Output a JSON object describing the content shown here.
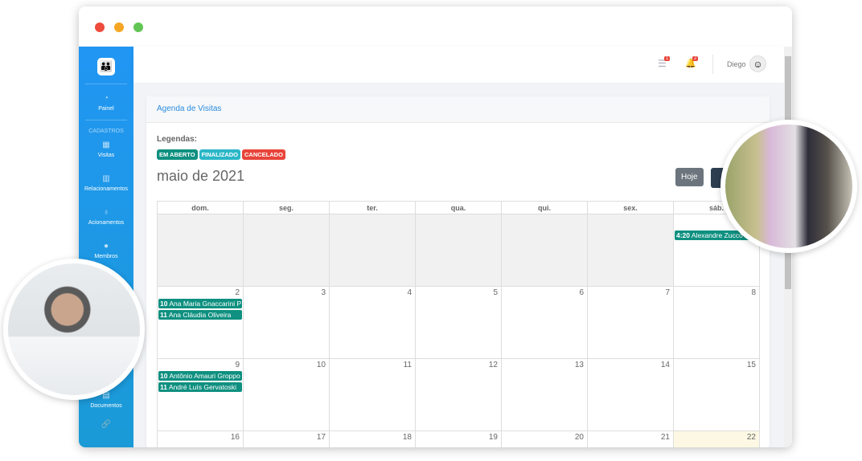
{
  "window": {
    "dots": [
      "#ee4b3d",
      "#f5a623",
      "#62c554"
    ]
  },
  "sidebar": {
    "items": [
      {
        "label": "Painel",
        "icon": "dashboard-icon"
      },
      {
        "label": "Visitas",
        "icon": "calendar-icon"
      },
      {
        "label": "Relacionamentos",
        "icon": "building-icon"
      },
      {
        "label": "Acionamentos",
        "icon": "stethoscope-icon"
      },
      {
        "label": "Membros",
        "icon": "user-icon"
      },
      {
        "label": "Documentos",
        "icon": "document-icon"
      }
    ],
    "section": "CADASTROS"
  },
  "header": {
    "tasks_count": "1",
    "notif_count": "2",
    "user": "Diego"
  },
  "card": {
    "title": "Agenda de Visitas",
    "legend_label": "Legendas:",
    "legends": [
      {
        "label": "EM ABERTO",
        "color": "#0f9080"
      },
      {
        "label": "FINALIZADO",
        "color": "#2bb7c7"
      },
      {
        "label": "CANCELADO",
        "color": "#e8443a"
      }
    ],
    "month": "maio de 2021",
    "today_button": "Hoje"
  },
  "calendar": {
    "days": [
      "dom.",
      "seg.",
      "ter.",
      "qua.",
      "qui.",
      "sex.",
      "sáb."
    ],
    "weeks": [
      {
        "cells": [
          "",
          "",
          "",
          "",
          "",
          "",
          ""
        ],
        "events_sat": [
          {
            "time": "4:20",
            "name": "Alexandre Zucco"
          }
        ]
      },
      {
        "cells": [
          "2",
          "3",
          "4",
          "5",
          "6",
          "7",
          "8"
        ],
        "events_sun": [
          {
            "time": "10",
            "name": "Ana Maria Gnaccarini P"
          },
          {
            "time": "11",
            "name": "Ana Cláudia Oliveira"
          }
        ]
      },
      {
        "cells": [
          "9",
          "10",
          "11",
          "12",
          "13",
          "14",
          "15"
        ],
        "events_sun": [
          {
            "time": "10",
            "name": "Antônio Amauri Groppo"
          },
          {
            "time": "11",
            "name": "André Luís Gervatoski"
          }
        ]
      },
      {
        "cells": [
          "16",
          "17",
          "18",
          "19",
          "20",
          "21",
          "22"
        ]
      }
    ]
  }
}
